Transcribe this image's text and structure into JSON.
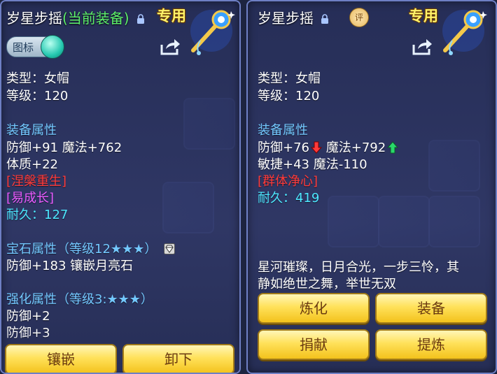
{
  "left": {
    "title_prefix": "岁星步摇",
    "title_highlight": "(当前装备)",
    "special": "专用",
    "toggle_label": "图标",
    "type": "类型：女帽",
    "level": "等级：120",
    "equip_attr_header": "装备属性",
    "attr1": "防御+91  魔法+762",
    "attr2": "体质+22",
    "effect1": "[涅槃重生]",
    "effect2": "[易成长]",
    "durability_label": "耐久：",
    "durability_value": "127",
    "gem_header": "宝石属性（等级12★★★）",
    "gem_line": "防御+183 镶嵌月亮石",
    "enhance_header": "强化属性（等级3:★★★）",
    "enhance1": "防御+2",
    "enhance2": "防御+3",
    "btn_inlay": "镶嵌",
    "btn_unequip": "卸下"
  },
  "right": {
    "title": "岁星步摇",
    "rating_badge": "评",
    "special": "专用",
    "type": "类型：女帽",
    "level": "等级：120",
    "equip_attr_header": "装备属性",
    "attr1_a": "防御+76",
    "attr1_b": "魔法+792",
    "attr2": "敏捷+43  魔法-110",
    "effect1": "[群体净心]",
    "durability_label": "耐久：",
    "durability_value": "419",
    "desc_line1": "星河璀璨，日月合光，一步三怜，其",
    "desc_line2": "静如绝世之舞，举世无双",
    "btn_refine": "炼化",
    "btn_equip": "装备",
    "btn_donate": "捐献",
    "btn_extract": "提炼"
  },
  "colors": {
    "section": "#73c8ff",
    "effect_red": "#ff3b3b",
    "effect_pink": "#e95bff",
    "durability": "#4de7ff",
    "highlight_green": "#5df06a",
    "special_gold": "#fff36a"
  },
  "icons": [
    "lock-icon",
    "share-icon",
    "hairpin-item-icon",
    "gem-icon",
    "arrow-down-icon",
    "arrow-up-icon",
    "rating-badge-icon"
  ]
}
